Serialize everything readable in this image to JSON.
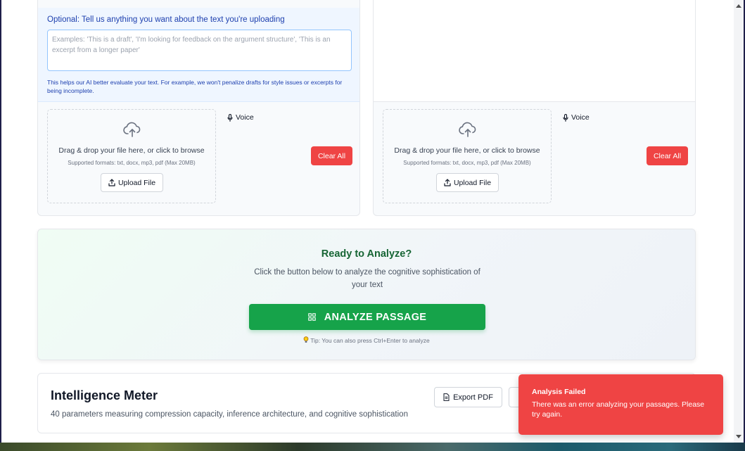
{
  "left_panel": {
    "optional_title": "Optional: Tell us anything you want about the text you're uploading",
    "notes_placeholder": "Examples: 'This is a draft', 'I'm looking for feedback on the argument structure', 'This is an excerpt from a longer paper'",
    "help_text": "This helps our AI better evaluate your text. For example, we won't penalize drafts for style issues or excerpts for being incomplete.",
    "dropzone_main": "Drag & drop your file here, or click to browse",
    "dropzone_formats": "Supported formats: txt, docx, mp3, pdf (Max 20MB)",
    "upload_label": "Upload File",
    "voice_label": "Voice",
    "clear_label": "Clear All"
  },
  "right_panel": {
    "dropzone_main": "Drag & drop your file here, or click to browse",
    "dropzone_formats": "Supported formats: txt, docx, mp3, pdf (Max 20MB)",
    "upload_label": "Upload File",
    "voice_label": "Voice",
    "clear_label": "Clear All"
  },
  "analyze": {
    "title": "Ready to Analyze?",
    "description": "Click the button below to analyze the cognitive sophistication of your text",
    "button_label": "ANALYZE PASSAGE",
    "tip": "Tip: You can also press Ctrl+Enter to analyze"
  },
  "meter": {
    "title": "Intelligence Meter",
    "description": "40 parameters measuring compression capacity, inference architecture, and cognitive sophistication",
    "export_label": "Export PDF"
  },
  "toast": {
    "title": "Analysis Failed",
    "message": "There was an error analyzing your passages. Please try again."
  },
  "colors": {
    "danger": "#ef4444",
    "success": "#16a34a",
    "info_text": "#1e40af"
  },
  "icons": [
    "cloud-upload-icon",
    "upload-icon",
    "microphone-icon",
    "grid-icon",
    "lightbulb-icon",
    "document-icon"
  ]
}
